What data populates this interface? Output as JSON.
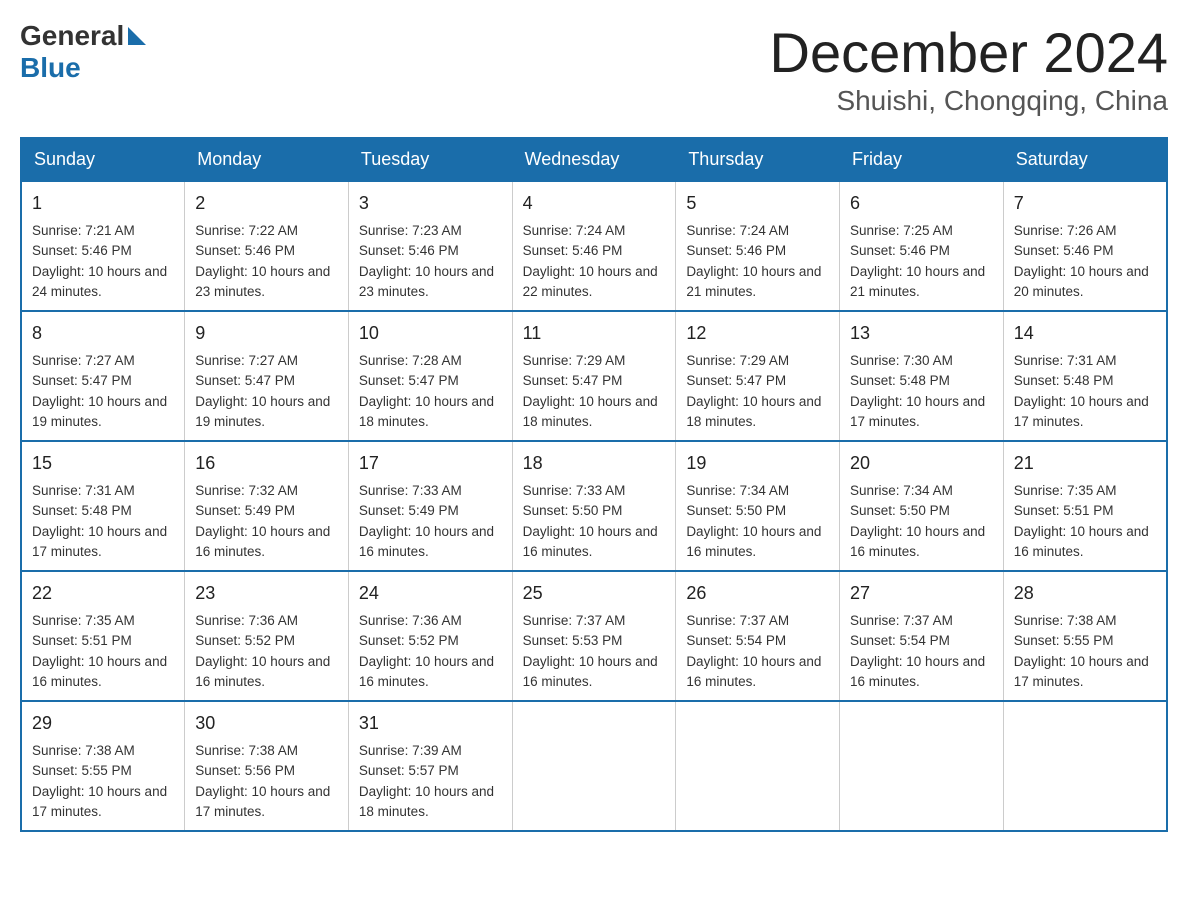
{
  "header": {
    "logo_general": "General",
    "logo_blue": "Blue",
    "month": "December 2024",
    "location": "Shuishi, Chongqing, China"
  },
  "days_of_week": [
    "Sunday",
    "Monday",
    "Tuesday",
    "Wednesday",
    "Thursday",
    "Friday",
    "Saturday"
  ],
  "weeks": [
    [
      {
        "day": "1",
        "sunrise": "7:21 AM",
        "sunset": "5:46 PM",
        "daylight": "10 hours and 24 minutes."
      },
      {
        "day": "2",
        "sunrise": "7:22 AM",
        "sunset": "5:46 PM",
        "daylight": "10 hours and 23 minutes."
      },
      {
        "day": "3",
        "sunrise": "7:23 AM",
        "sunset": "5:46 PM",
        "daylight": "10 hours and 23 minutes."
      },
      {
        "day": "4",
        "sunrise": "7:24 AM",
        "sunset": "5:46 PM",
        "daylight": "10 hours and 22 minutes."
      },
      {
        "day": "5",
        "sunrise": "7:24 AM",
        "sunset": "5:46 PM",
        "daylight": "10 hours and 21 minutes."
      },
      {
        "day": "6",
        "sunrise": "7:25 AM",
        "sunset": "5:46 PM",
        "daylight": "10 hours and 21 minutes."
      },
      {
        "day": "7",
        "sunrise": "7:26 AM",
        "sunset": "5:46 PM",
        "daylight": "10 hours and 20 minutes."
      }
    ],
    [
      {
        "day": "8",
        "sunrise": "7:27 AM",
        "sunset": "5:47 PM",
        "daylight": "10 hours and 19 minutes."
      },
      {
        "day": "9",
        "sunrise": "7:27 AM",
        "sunset": "5:47 PM",
        "daylight": "10 hours and 19 minutes."
      },
      {
        "day": "10",
        "sunrise": "7:28 AM",
        "sunset": "5:47 PM",
        "daylight": "10 hours and 18 minutes."
      },
      {
        "day": "11",
        "sunrise": "7:29 AM",
        "sunset": "5:47 PM",
        "daylight": "10 hours and 18 minutes."
      },
      {
        "day": "12",
        "sunrise": "7:29 AM",
        "sunset": "5:47 PM",
        "daylight": "10 hours and 18 minutes."
      },
      {
        "day": "13",
        "sunrise": "7:30 AM",
        "sunset": "5:48 PM",
        "daylight": "10 hours and 17 minutes."
      },
      {
        "day": "14",
        "sunrise": "7:31 AM",
        "sunset": "5:48 PM",
        "daylight": "10 hours and 17 minutes."
      }
    ],
    [
      {
        "day": "15",
        "sunrise": "7:31 AM",
        "sunset": "5:48 PM",
        "daylight": "10 hours and 17 minutes."
      },
      {
        "day": "16",
        "sunrise": "7:32 AM",
        "sunset": "5:49 PM",
        "daylight": "10 hours and 16 minutes."
      },
      {
        "day": "17",
        "sunrise": "7:33 AM",
        "sunset": "5:49 PM",
        "daylight": "10 hours and 16 minutes."
      },
      {
        "day": "18",
        "sunrise": "7:33 AM",
        "sunset": "5:50 PM",
        "daylight": "10 hours and 16 minutes."
      },
      {
        "day": "19",
        "sunrise": "7:34 AM",
        "sunset": "5:50 PM",
        "daylight": "10 hours and 16 minutes."
      },
      {
        "day": "20",
        "sunrise": "7:34 AM",
        "sunset": "5:50 PM",
        "daylight": "10 hours and 16 minutes."
      },
      {
        "day": "21",
        "sunrise": "7:35 AM",
        "sunset": "5:51 PM",
        "daylight": "10 hours and 16 minutes."
      }
    ],
    [
      {
        "day": "22",
        "sunrise": "7:35 AM",
        "sunset": "5:51 PM",
        "daylight": "10 hours and 16 minutes."
      },
      {
        "day": "23",
        "sunrise": "7:36 AM",
        "sunset": "5:52 PM",
        "daylight": "10 hours and 16 minutes."
      },
      {
        "day": "24",
        "sunrise": "7:36 AM",
        "sunset": "5:52 PM",
        "daylight": "10 hours and 16 minutes."
      },
      {
        "day": "25",
        "sunrise": "7:37 AM",
        "sunset": "5:53 PM",
        "daylight": "10 hours and 16 minutes."
      },
      {
        "day": "26",
        "sunrise": "7:37 AM",
        "sunset": "5:54 PM",
        "daylight": "10 hours and 16 minutes."
      },
      {
        "day": "27",
        "sunrise": "7:37 AM",
        "sunset": "5:54 PM",
        "daylight": "10 hours and 16 minutes."
      },
      {
        "day": "28",
        "sunrise": "7:38 AM",
        "sunset": "5:55 PM",
        "daylight": "10 hours and 17 minutes."
      }
    ],
    [
      {
        "day": "29",
        "sunrise": "7:38 AM",
        "sunset": "5:55 PM",
        "daylight": "10 hours and 17 minutes."
      },
      {
        "day": "30",
        "sunrise": "7:38 AM",
        "sunset": "5:56 PM",
        "daylight": "10 hours and 17 minutes."
      },
      {
        "day": "31",
        "sunrise": "7:39 AM",
        "sunset": "5:57 PM",
        "daylight": "10 hours and 18 minutes."
      },
      null,
      null,
      null,
      null
    ]
  ],
  "labels": {
    "sunrise": "Sunrise:",
    "sunset": "Sunset:",
    "daylight": "Daylight:"
  }
}
